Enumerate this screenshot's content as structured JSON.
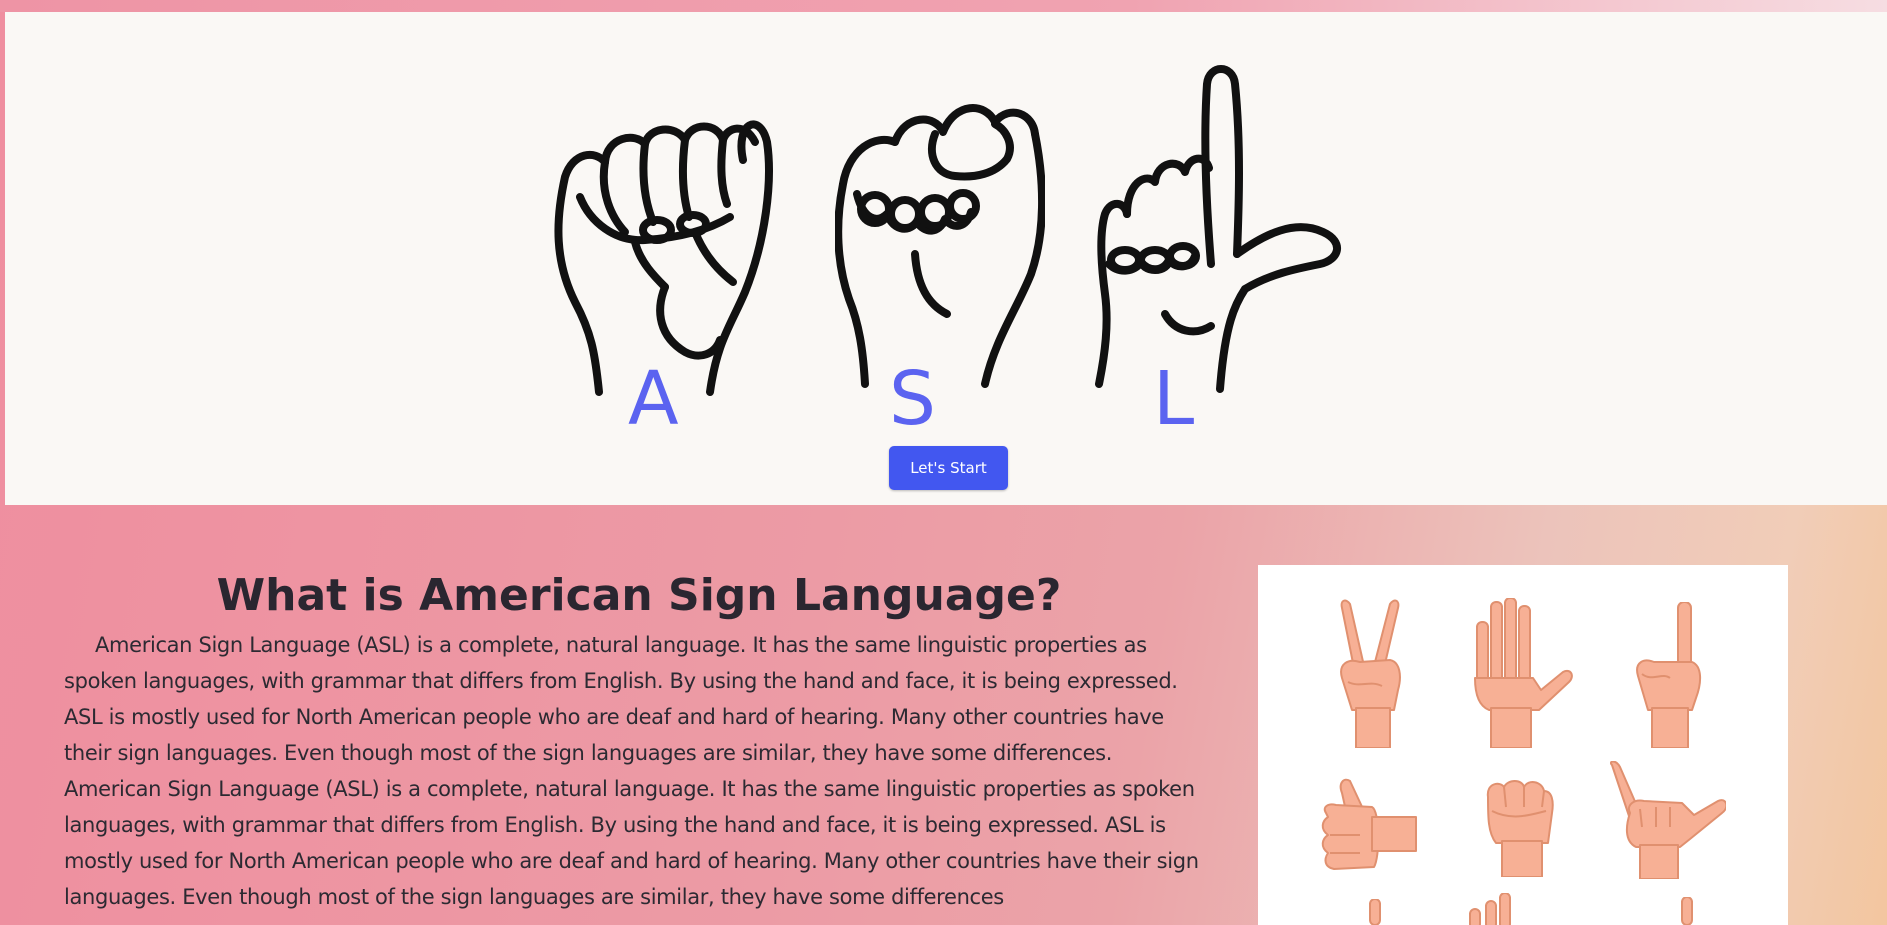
{
  "hero": {
    "letters": [
      "A",
      "S",
      "L"
    ],
    "start_button": "Let's Start",
    "letter_color": "#5b63f0",
    "button_color": "#4257f0"
  },
  "info": {
    "title": "What is American Sign Language?",
    "paragraph_1": "American Sign Language (ASL) is a complete, natural language. It has the same linguistic properties as spoken languages, with grammar that differs from English. By using the hand and face, it is being expressed. ASL is mostly used for North American people who are deaf and hard of hearing. Many other countries have their sign languages. Even though most of the sign languages are similar, they have some differences.",
    "paragraph_2": "American Sign Language (ASL) is a complete, natural language. It has the same linguistic properties as spoken languages, with grammar that differs from English. By using the hand and face, it is being expressed. ASL is mostly used for North American people who are deaf and hard of hearing. Many other countries have their sign languages. Even though most of the sign languages are similar, they have some differences"
  },
  "signs_card": {
    "icons": [
      "peace-sign-hand-icon",
      "open-palm-hand-icon",
      "index-finger-up-hand-icon",
      "thumbs-up-hand-icon",
      "fist-hand-icon",
      "i-love-you-hand-icon"
    ],
    "skin_color": "#f7b095"
  }
}
